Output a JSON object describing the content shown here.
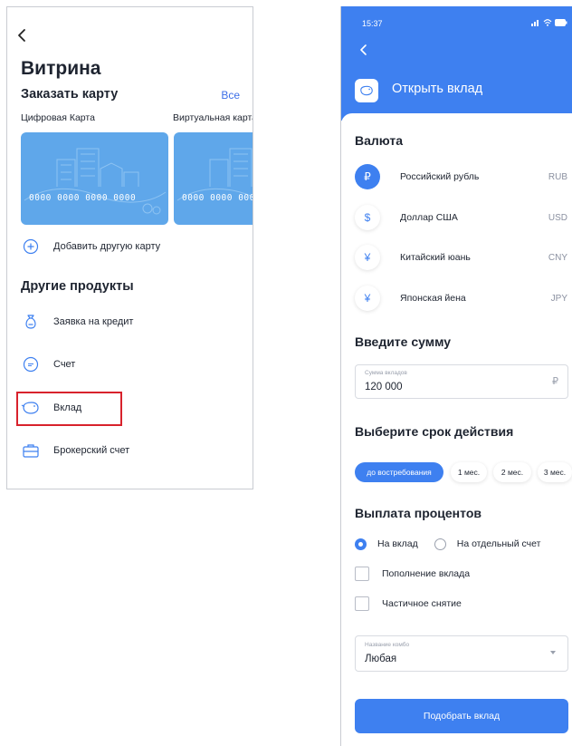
{
  "left": {
    "title": "Витрина",
    "order_card": {
      "heading": "Заказать карту",
      "all_link": "Все"
    },
    "cards": [
      {
        "label": "Цифровая Карта",
        "number": "0000 0000 0000 0000"
      },
      {
        "label": "Виртуальная карта",
        "number": "0000 0000 0000 0000"
      }
    ],
    "add_card": "Добавить другую карту",
    "other_products": {
      "heading": "Другие продукты",
      "items": [
        {
          "label": "Заявка на кредит",
          "icon": "money-bag-icon"
        },
        {
          "label": "Счет",
          "icon": "account-circle-icon"
        },
        {
          "label": "Вклад",
          "icon": "piggy-bank-icon",
          "highlighted": true
        },
        {
          "label": "Брокерский счет",
          "icon": "briefcase-icon"
        }
      ]
    },
    "colors": {
      "card": "#5fa7ea",
      "accent": "#3d6fe8",
      "highlight": "#d8222c"
    }
  },
  "right": {
    "status": {
      "time": "15:37"
    },
    "header": {
      "title": "Открыть вклад"
    },
    "currency": {
      "heading": "Валюта",
      "items": [
        {
          "symbol": "₽",
          "name": "Российский рубль",
          "code": "RUB",
          "selected": true
        },
        {
          "symbol": "$",
          "name": "Доллар США",
          "code": "USD",
          "selected": false
        },
        {
          "symbol": "¥",
          "name": "Китайский юань",
          "code": "CNY",
          "selected": false
        },
        {
          "symbol": "¥",
          "name": "Японская йена",
          "code": "JPY",
          "selected": false
        }
      ]
    },
    "amount": {
      "heading": "Введите сумму",
      "label": "Сумма вкладов",
      "value": "120 000",
      "currency": "₽"
    },
    "term": {
      "heading": "Выберите срок действия",
      "options": [
        "до востребования",
        "1 мес.",
        "2 мес.",
        "3 мес."
      ],
      "selected": "до востребования"
    },
    "interest": {
      "heading": "Выплата процентов",
      "options": [
        {
          "label": "На вклад",
          "selected": true
        },
        {
          "label": "На отдельный счет",
          "selected": false
        }
      ],
      "checkboxes": [
        {
          "label": "Пополнение вклада",
          "checked": false
        },
        {
          "label": "Частичное снятие",
          "checked": false
        }
      ]
    },
    "combo": {
      "label": "Название комбо",
      "value": "Любая"
    },
    "submit": "Подобрать вклад",
    "colors": {
      "primary": "#3e80f0"
    }
  }
}
